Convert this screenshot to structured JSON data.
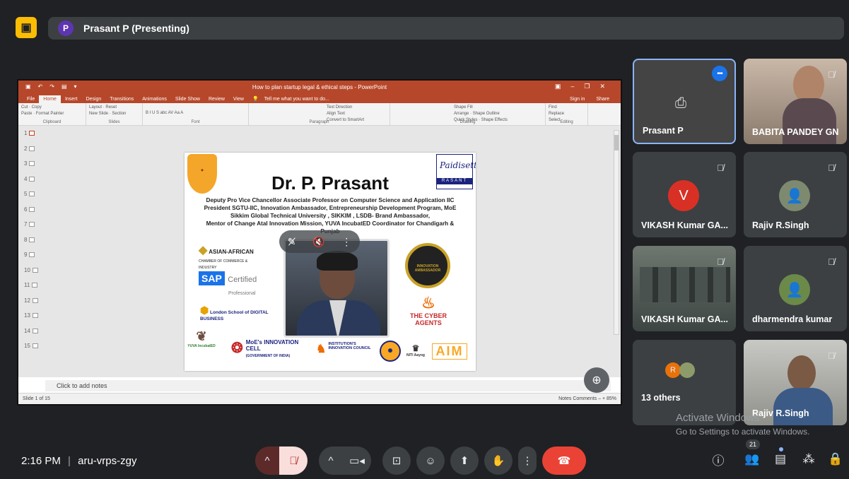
{
  "header": {
    "presenter_initial": "P",
    "presenting_label": "Prasant P (Presenting)"
  },
  "ppt": {
    "doc_title": "How to plan startup legal & ethical steps - PowerPoint",
    "tabs": [
      "File",
      "Home",
      "Insert",
      "Design",
      "Transitions",
      "Animations",
      "Slide Show",
      "Review",
      "View"
    ],
    "tell_me": "Tell me what you want to do...",
    "sign_in": "Sign in",
    "share": "Share",
    "groups": [
      {
        "label": "Clipboard",
        "items": [
          "Cut",
          "Copy",
          "Format Painter",
          "Paste"
        ]
      },
      {
        "label": "Slides",
        "items": [
          "Layout",
          "Reset",
          "Section",
          "New Slide"
        ]
      },
      {
        "label": "Font",
        "items": [
          "B I U S abc AV Aa A"
        ]
      },
      {
        "label": "Paragraph",
        "items": [
          "Text Direction",
          "Align Text",
          "Convert to SmartArt"
        ]
      },
      {
        "label": "Drawing",
        "items": [
          "Arrange",
          "Quick Styles",
          "Shape Fill",
          "Shape Outline",
          "Shape Effects"
        ]
      },
      {
        "label": "Editing",
        "items": [
          "Find",
          "Replace",
          "Select"
        ]
      }
    ],
    "thumbnails": [
      "1",
      "2",
      "3",
      "4",
      "5",
      "6",
      "7",
      "8",
      "9",
      "10",
      "11",
      "12",
      "13",
      "14",
      "15"
    ],
    "notes_placeholder": "Click to add notes",
    "status_left": "Slide 1 of 15",
    "status_right": "Notes   Comments        –   + 85%"
  },
  "slide": {
    "name": "Dr. P. Prasant",
    "lines": [
      "Deputy Pro Vice Chancellor  Associate Professor on Computer Science and Application IIC",
      "President SGTU-IIC, Innovation Ambassador, Entrepreneurship Development Program, MoE",
      "Sikkim Global Technical University , SIKKIM , LSDB- Brand Ambassador,",
      "Mentor of Change Atal Innovation Mission, YUVA IncubatED Coordinator for Chandigarh &",
      "Punjab"
    ],
    "sig_text": "Paidisetti",
    "sig_bar": "RASANT",
    "logo_aacci": "ASIAN-AFRICAN",
    "logo_aacci_sub": "CHAMBER OF COMMERCE & INDUSTRY",
    "logo_sap": "SAP",
    "logo_sap_cert": "Certified",
    "logo_sap_prof": "Professional",
    "logo_lsdb": "London School of DIGITAL BUSINESS",
    "logo_yuva": "YUVA IncubatED",
    "logo_moe": "MoE's INNOVATION CELL",
    "logo_moe_sub": "(GOVERNMENT OF INDIA)",
    "logo_iic": "INSTITUTION'S INNOVATION COUNCIL",
    "logo_niti": "NITI Aayog",
    "logo_aim": "AIM",
    "logo_cyber": "THE CYBER AGENTS",
    "logo_ambassador": "INNOVATION AMBASSADOR"
  },
  "participants": [
    {
      "name": "Prasant P",
      "kind": "presenting"
    },
    {
      "name": "BABITA PANDEY GN",
      "kind": "video"
    },
    {
      "name": "VIKASH Kumar GA...",
      "kind": "avatar",
      "initial": "V",
      "color": "#d93025"
    },
    {
      "name": "Rajiv R.Singh",
      "kind": "photo"
    },
    {
      "name": "VIKASH Kumar GA...",
      "kind": "video"
    },
    {
      "name": "dharmendra kumar",
      "kind": "photo"
    },
    {
      "name": "13 others",
      "kind": "others",
      "initial": "R"
    },
    {
      "name": "Rajiv R.Singh",
      "kind": "video"
    }
  ],
  "activate": {
    "title": "Activate Windows",
    "sub": "Go to Settings to activate Windows."
  },
  "footer": {
    "time": "2:16 PM",
    "divider": "|",
    "meeting_code": "aru-vrps-zgy",
    "people_count": "21"
  },
  "colors": {
    "accent": "#8ab4f8",
    "end_call": "#ea4335",
    "mic_off_bg": "#f9dedc",
    "ppt_red": "#b7472a"
  }
}
